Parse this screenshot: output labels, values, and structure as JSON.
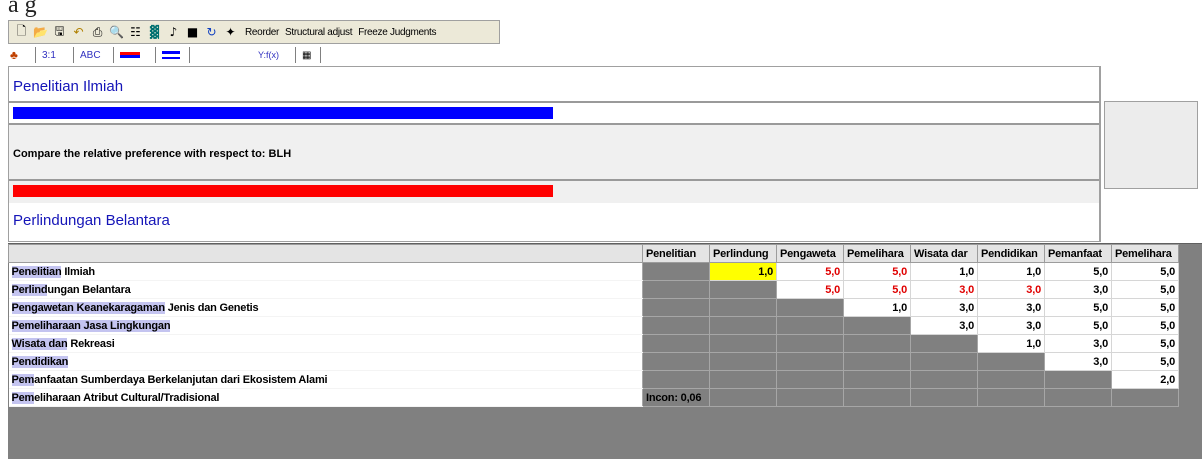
{
  "toolbar": {
    "icons": [
      "new-icon",
      "open-icon",
      "save-icon",
      "undo-icon",
      "print-icon",
      "preview-icon",
      "hierarchy-icon",
      "calculator-icon",
      "music-icon",
      "square-icon",
      "refresh-icon",
      "wand-icon"
    ],
    "reorder": "Reorder",
    "structural": "Structural adjust",
    "freeze": "Freeze Judgments"
  },
  "tabs": {
    "t1": "3:1",
    "t2": "ABC",
    "t5": "Y:f(x)"
  },
  "compare": {
    "top_label": "Penelitian Ilmiah",
    "question": "Compare the relative preference  with respect to: BLH",
    "bottom_label": "Perlindungan Belantara",
    "top_bar_color": "#0000ff",
    "bottom_bar_color": "#ff0000"
  },
  "matrix": {
    "columns": [
      "Penelitian",
      "Perlindung",
      "Pengaweta",
      "Pemelihara",
      "Wisata dar",
      "Pendidikan",
      "Pemanfaat",
      "Pemelihara"
    ],
    "rows": [
      {
        "hl": "Penelitian",
        "rest": " Ilmiah"
      },
      {
        "hl": "Perlind",
        "rest": "ungan Belantara"
      },
      {
        "hl": "Pengawetan Keanekaragaman",
        "rest": " Jenis dan Genetis"
      },
      {
        "hl": "Pemeliharaan Jasa Lingkungan",
        "rest": ""
      },
      {
        "hl": "Wisata dan",
        "rest": " Rekreasi"
      },
      {
        "hl": "Pendidikan",
        "rest": ""
      },
      {
        "hl": "Pem",
        "rest": "anfaatan Sumberdaya Berkelanjutan dari Ekosistem Alami"
      },
      {
        "hl": "Pem",
        "rest": "eliharaan Atribut Cultural/Tradisional"
      }
    ],
    "values": [
      [
        "",
        "1,0",
        "5,0",
        "5,0",
        "1,0",
        "1,0",
        "5,0",
        "5,0"
      ],
      [
        "",
        "",
        "5,0",
        "5,0",
        "3,0",
        "3,0",
        "3,0",
        "5,0"
      ],
      [
        "",
        "",
        "",
        "1,0",
        "3,0",
        "3,0",
        "5,0",
        "5,0"
      ],
      [
        "",
        "",
        "",
        "",
        "3,0",
        "3,0",
        "5,0",
        "5,0"
      ],
      [
        "",
        "",
        "",
        "",
        "",
        "1,0",
        "3,0",
        "5,0"
      ],
      [
        "",
        "",
        "",
        "",
        "",
        "",
        "3,0",
        "5,0"
      ],
      [
        "",
        "",
        "",
        "",
        "",
        "",
        "",
        "2,0"
      ],
      [
        "",
        "",
        "",
        "",
        "",
        "",
        "",
        ""
      ]
    ],
    "red_cells": [
      [
        0,
        2
      ],
      [
        0,
        3
      ],
      [
        1,
        2
      ],
      [
        1,
        3
      ],
      [
        1,
        4
      ],
      [
        1,
        5
      ]
    ],
    "yellow_cell": [
      0,
      1
    ],
    "incon": "Incon: 0,06"
  }
}
